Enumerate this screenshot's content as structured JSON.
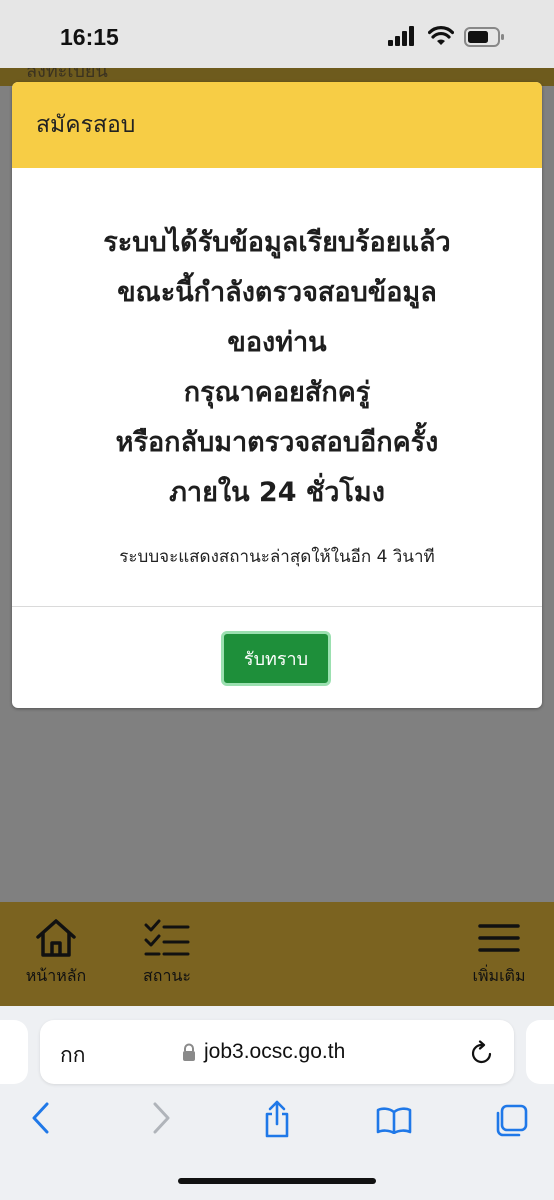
{
  "status_bar": {
    "time": "16:15",
    "icons": [
      "cellular-signal-icon",
      "wifi-icon",
      "battery-icon"
    ]
  },
  "page_header": {
    "partial_text": "ลงทะเบียน"
  },
  "modal": {
    "title": "สมัครสอบ",
    "message_lines": [
      "ระบบได้รับข้อมูลเรียบร้อยแล้ว",
      "ขณะนี้กำลังตรวจสอบข้อมูล",
      "ของท่าน",
      "กรุณาคอยสักครู่",
      "หรือกลับมาตรวจสอบอีกครั้ง",
      "ภายใน 24 ชั่วโมง"
    ],
    "countdown_text": "ระบบจะแสดงสถานะล่าสุดให้ในอีก 4 วินาที",
    "ack_button_label": "รับทราบ",
    "colors": {
      "header": "#f7cd45",
      "button": "#1e8f3a"
    }
  },
  "bottom_nav": {
    "items": [
      {
        "label": "หน้าหลัก",
        "icon": "home-icon"
      },
      {
        "label": "สถานะ",
        "icon": "checklist-icon"
      },
      {
        "label": "เพิ่มเติม",
        "icon": "hamburger-menu-icon"
      }
    ],
    "color": "#7b6320"
  },
  "browser": {
    "text_size_label": "กก",
    "url": "job3.ocsc.go.th",
    "toolbar_icons": [
      "back-icon",
      "forward-icon",
      "share-icon",
      "bookmarks-icon",
      "tabs-icon"
    ]
  }
}
